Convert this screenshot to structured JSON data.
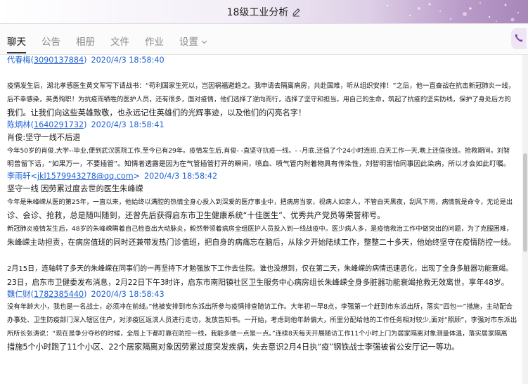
{
  "window": {
    "title": "18级工业分析"
  },
  "tabs": [
    {
      "label": "聊天"
    },
    {
      "label": "公告"
    },
    {
      "label": "相册"
    },
    {
      "label": "文件"
    },
    {
      "label": "作业"
    },
    {
      "label": "设置"
    }
  ],
  "colors": {
    "link": "#1d62d6",
    "text": "#1a1a1a",
    "accent": "#a786b8"
  },
  "messages": [
    {
      "sender": "代春梅",
      "sender_id": "3090137884",
      "time": "2020/4/3 18:58:40",
      "lines": [
        "",
        "疫情发生后，湖北孝感医生黄文军写下请战书：“苟利国家生死以，岂因祸福避趋之。我申请去隔离病房，共赴国难，听从组织安排！”之后，他一直奋战在抗击新冠肺炎一线，",
        "后不幸感染，英勇殉职！为抗疫而牺牲的医护人员，还有很多，面对疫情，他们选择了逆向而行，选择了坚守和担当。用自己的生命，筑起了抗疫的坚实防线，保护了身处后方的",
        "我们。让我们向这些英雄致敬，也永远记住英雄们的光辉事迹，以及他们的闪亮名字！"
      ]
    },
    {
      "sender": "陈炳林",
      "sender_id": "1640291732",
      "time": "2020/4/3 18:58:41",
      "lines": [
        "肖俊:坚守一线不后退",
        "今年50岁的肖俊,大学--毕业,便到武汉医院工作,至今已有29年。疫情发生后,肖俊- -直坚守抗疫一线。- -月底,还值了个24小时连班,白天工作一天,晚上还值夜班。抢救期间，刘智",
        "明曾留下话，“如果万一，不要插管”。知情者透露是因为在气管插管打开的瞬间，喷血、喷气管内附着物具有传染性，刘智明害怕同事因此染病，所以才会如此叮嘱。"
      ]
    },
    {
      "sender": "李雨轩",
      "sender_id": "jkl1579943278@qq.com",
      "time": "2020/4/3 18:58:42",
      "lines": [
        "坚守一线 因劳累过度去世的医生朱峰嵘",
        "今年是朱峰嵘从医的第25年，一直以来，他始终以满腔的热情全身心投入到深爱的医疗事业中，把病房当家，视病人如亲人，不管白天黑夜，刮风下雨，病情就是命令，无论是出",
        "诊、会诊、抢救，总是随叫随到，还曾先后获得启东市卫生健康系统“十佳医生”、优秀共产党员等荣誉称号。",
        "新冠肺炎疫情发生后，48岁的朱峰嵘瞒着自己检查出大动脉炎，毅然带领着病房全组医护人员投入到一线战疫中。医少病人多，是疫情救治工作中做突出的问题，为了克服困难，",
        "朱峰嵘主动担责，在病房值班的同时还兼带发热门诊值班，把自身的病痛忘在脑后，从除夕开始陆续工作，整整二十多天，他始终坚守在疫情防控一线。",
        "",
        "2月15日，连轴转了多天的朱峰嵘在同事们的一再坚持下才勉强放下工作去住院。谁也没想到，仅在第二天，朱峰嵘的病情迅速恶化，出现了全身多脏器功能衰竭。",
        "23日，启东市卫健委发布消息，2月22日下午3时许，启东市南阳镇社区卫生服务中心病房组长朱峰嵘全身多脏器功能衰竭抢救无效离世，享年48岁。"
      ]
    },
    {
      "sender": "魏仁财",
      "sender_id": "1782385440",
      "time": "2020/4/3 18:58:43",
      "lines": [
        "没有年龄大小，我也是一名战士，必须冲在前线。”他被安排到市东派出所参与疫情排查随访工作。大年初一早8点，李强第一个赶到市东派出所，落实“四包一”措施，主动配合",
        "办事处、卫生防疫部门深入辖区住户，对涉疫区返滨人员进行走访，发放告知书。一开始，考虑到他年龄偏大，所里分配给他的工作任务相对较少,面对“照顾”，李强对市东派出",
        "所所长张涛说：“现在是争分夺秒的时候，全局上下都盯靠在防控一线，我能多做一点是一点。”连续8天每天开展随访工作11个小时上门为居家隔离对象测量体温，落实居家隔离",
        "措施5个小时跑了11个小区、22个居家隔离对象因劳累过度突发疾病，失去意识2月4日执“疫”钢铁战士李强被省公安厅记一等功。"
      ]
    }
  ]
}
